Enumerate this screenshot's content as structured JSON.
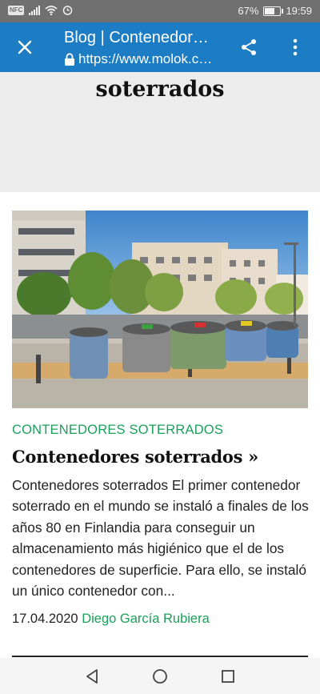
{
  "status_bar": {
    "carrier_badge": "NFC",
    "battery_percent": "67%",
    "battery_level": 0.67,
    "time": "19:59"
  },
  "browser": {
    "title": "Blog | Contenedor…",
    "url": "https://www.molok.c…",
    "toolbar_color": "#1c7dc5"
  },
  "hero": {
    "heading": "soterrados"
  },
  "article": {
    "category": "CONTENEDORES SOTERRADOS",
    "title": "Contenedores soterrados »",
    "excerpt": "Contenedores soterrados El primer contenedor soterrado en el mundo se instaló a finales de los años 80 en Finlandia para conseguir un almacenamiento más higiénico que el de los contenedores de superficie. Para ello, se instaló un único contenedor con...",
    "date": "17.04.2020",
    "author": "Diego García Rubiera",
    "accent_color": "#1aa05a"
  },
  "nav_bar": {
    "back": "back-icon",
    "home": "home-icon",
    "recents": "recents-icon"
  }
}
